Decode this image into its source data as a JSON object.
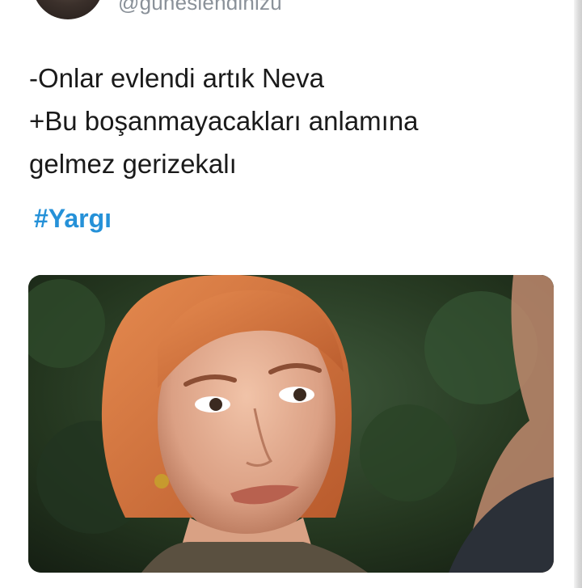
{
  "tweet": {
    "author_handle": "@gunesiendinizu",
    "text_lines": [
      "-Onlar evlendi artık Neva",
      "+Bu boşanmayacakları anlamına",
      "gelmez gerizekalı"
    ],
    "hashtag": "#Yargı",
    "colors": {
      "text": "#1a1a1a",
      "hashtag": "#2591d8",
      "handle": "#8a9199"
    },
    "media": {
      "description_icon": "photo-icon"
    }
  }
}
